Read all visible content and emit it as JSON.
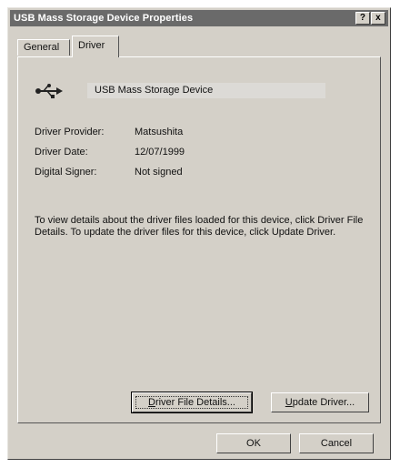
{
  "window": {
    "title": "USB Mass Storage Device Properties",
    "help_button": "?",
    "close_button": "x"
  },
  "tabs": [
    {
      "label": "General",
      "selected": false
    },
    {
      "label": "Driver",
      "selected": true
    }
  ],
  "device": {
    "icon": "usb-icon",
    "name": "USB Mass Storage Device"
  },
  "driver_info": {
    "provider_label": "Driver Provider:",
    "provider_value": "Matsushita",
    "date_label": "Driver Date:",
    "date_value": "12/07/1999",
    "signer_label": "Digital Signer:",
    "signer_value": "Not signed"
  },
  "description": "To view details about the driver files loaded for this device, click Driver File Details.  To update the driver files for this device, click Update Driver.",
  "buttons": {
    "driver_file_details_accel": "D",
    "driver_file_details_rest": "river File Details...",
    "update_driver_accel": "U",
    "update_driver_rest": "pdate Driver...",
    "ok": "OK",
    "cancel": "Cancel"
  }
}
